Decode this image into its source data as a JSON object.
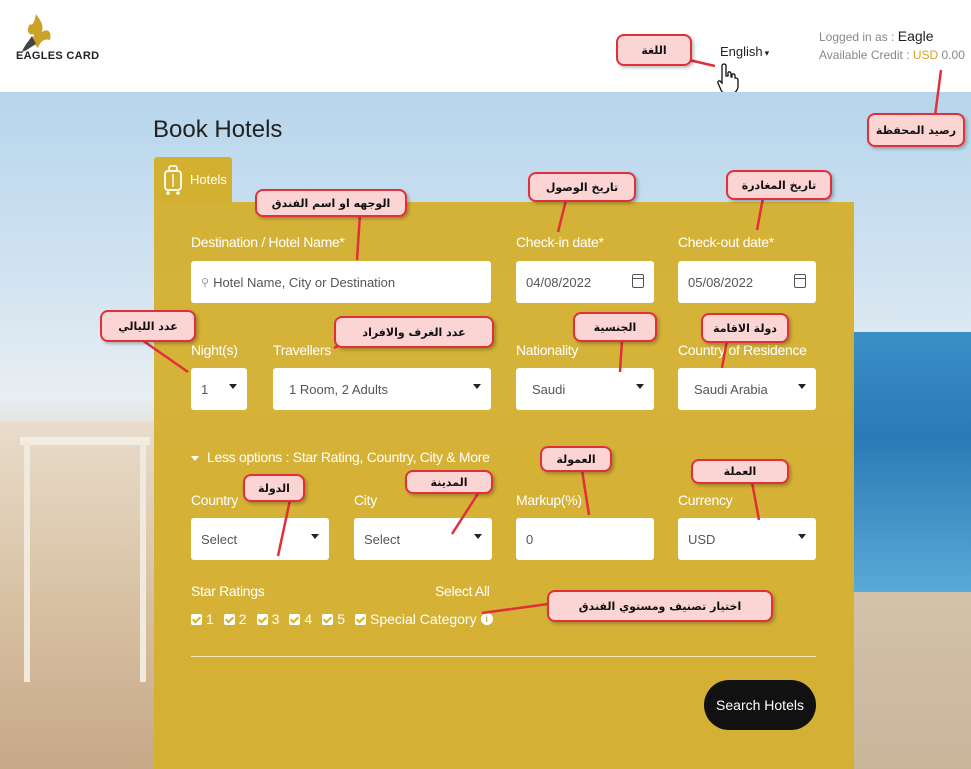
{
  "header": {
    "logo_text": "EAGLES CARD",
    "language": "English",
    "logged_in_label": "Logged in as :",
    "username": "Eagle",
    "credit_label": "Available Credit :",
    "credit_currency": "USD",
    "credit_amount": "0.00"
  },
  "page_title": "Book Hotels",
  "tab": {
    "label": "Hotels"
  },
  "form": {
    "destination": {
      "label": "Destination / Hotel Name*",
      "placeholder": "Hotel Name, City or Destination"
    },
    "checkin": {
      "label": "Check-in date*",
      "value": "04/08/2022"
    },
    "checkout": {
      "label": "Check-out date*",
      "value": "05/08/2022"
    },
    "nights": {
      "label": "Night(s)",
      "value": "1"
    },
    "travellers": {
      "label": "Travellers",
      "value": "1 Room, 2 Adults"
    },
    "nationality": {
      "label": "Nationality",
      "value": "Saudi"
    },
    "residence": {
      "label": "Country of Residence",
      "value": "Saudi Arabia"
    },
    "less_options": "Less options : Star Rating, Country, City & More",
    "country": {
      "label": "Country",
      "value": "Select"
    },
    "city": {
      "label": "City",
      "value": "Select"
    },
    "markup": {
      "label": "Markup(%)",
      "value": "0"
    },
    "currency": {
      "label": "Currency",
      "value": "USD"
    },
    "star_ratings_label": "Star Ratings",
    "select_all": "Select All",
    "stars": [
      "1",
      "2",
      "3",
      "4",
      "5"
    ],
    "special_category": "Special Category",
    "search_button": "Search Hotels"
  },
  "callouts": {
    "language": "اللغة",
    "wallet": "رصيد المحفظة",
    "destination": "الوجهه او اسم الفندق",
    "checkin": "تاريخ الوصول",
    "checkout": "تاريخ المغادرة",
    "nights": "عدد الليالي",
    "rooms": "عدد الغرف والافراد",
    "nationality": "الجنسية",
    "residence": "دولة الاقامة",
    "markup": "العمولة",
    "currency": "العملة",
    "country": "الدولة",
    "city": "المدينة",
    "stars": "اختيار تصنيف ومستوي الفندق"
  },
  "colors": {
    "accent": "#d4b030",
    "callout_border": "#e0303a",
    "callout_fill": "#fbd4d4"
  }
}
